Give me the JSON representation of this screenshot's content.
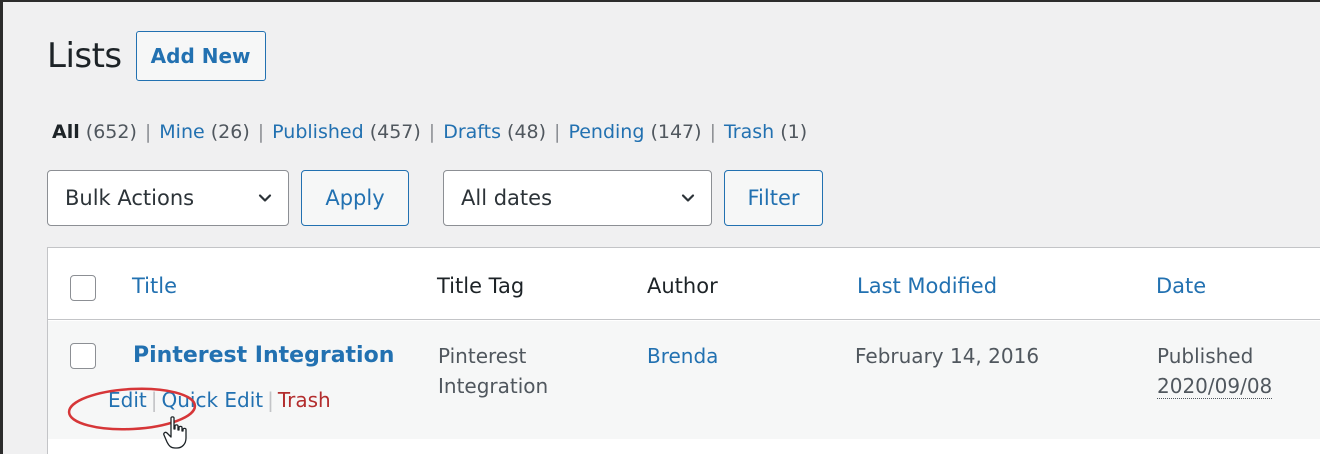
{
  "page": {
    "title": "Lists",
    "add_new_label": "Add New"
  },
  "views": [
    {
      "label": "All",
      "count": "(652)",
      "current": true
    },
    {
      "label": "Mine",
      "count": "(26)"
    },
    {
      "label": "Published",
      "count": "(457)"
    },
    {
      "label": "Drafts",
      "count": "(48)"
    },
    {
      "label": "Pending",
      "count": "(147)"
    },
    {
      "label": "Trash",
      "count": "(1)"
    }
  ],
  "separator": "|",
  "tablenav": {
    "bulk_actions": "Bulk Actions",
    "apply_label": "Apply",
    "dates": "All dates",
    "filter_label": "Filter"
  },
  "columns": {
    "title": "Title",
    "title_tag": "Title Tag",
    "author": "Author",
    "last_modified": "Last Modified",
    "date": "Date"
  },
  "rows": [
    {
      "title": "Pinterest Integration",
      "title_tag_line1": "Pinterest",
      "title_tag_line2": "Integration",
      "author": "Brenda",
      "last_modified": "February 14, 2016",
      "status": "Published",
      "date": "2020/09/08",
      "actions": {
        "edit": "Edit",
        "quick_edit": "Quick Edit",
        "trash": "Trash"
      }
    }
  ],
  "colors": {
    "link": "#2271b1",
    "trash": "#b32d2e",
    "annotation": "#d63638"
  }
}
